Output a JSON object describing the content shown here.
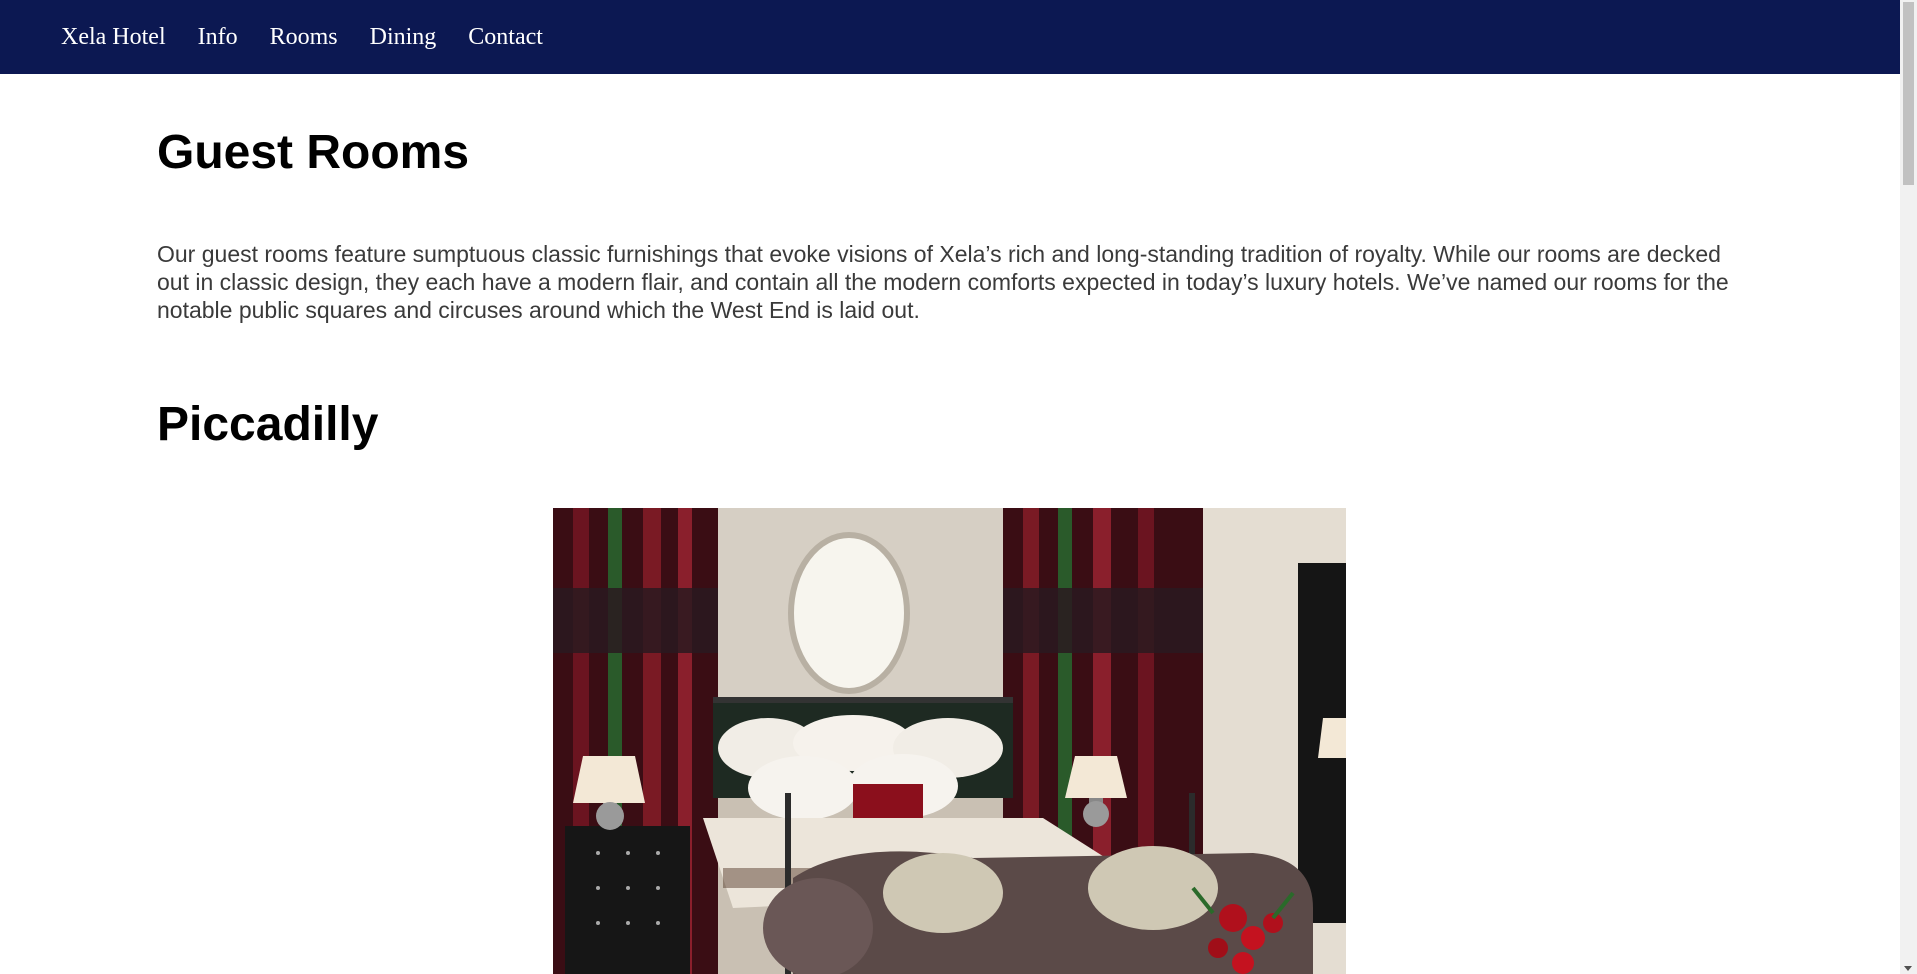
{
  "nav": {
    "items": [
      {
        "label": "Xela Hotel"
      },
      {
        "label": "Info"
      },
      {
        "label": "Rooms"
      },
      {
        "label": "Dining"
      },
      {
        "label": "Contact"
      }
    ]
  },
  "main": {
    "title": "Guest Rooms",
    "intro": "Our guest rooms feature sumptuous classic furnishings that evoke visions of Xela’s rich and long-standing tradition of royalty. While our rooms are decked out in classic design, they each have a modern flair, and contain all the modern comforts expected in today’s luxury hotels. We’ve named our rooms for the notable public squares and circuses around which the West End is laid out.",
    "rooms": [
      {
        "name": "Piccadilly"
      }
    ]
  },
  "colors": {
    "nav_background": "#0c1852",
    "nav_text": "#ffffff",
    "heading": "#000000",
    "body_text": "#3a3a3a"
  }
}
